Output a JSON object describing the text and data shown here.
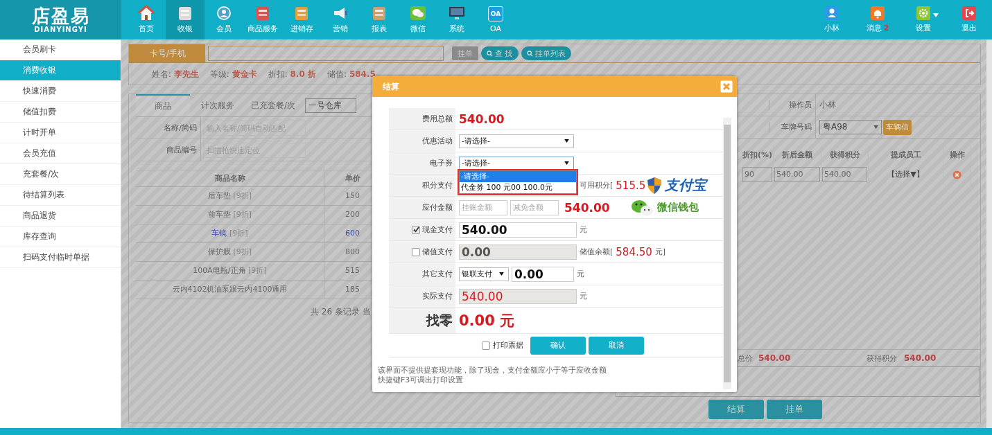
{
  "logo": {
    "name": "店盈易",
    "subtitle": "DIANYINGYI"
  },
  "nav": [
    {
      "label": "首页",
      "selected": false
    },
    {
      "label": "收银",
      "selected": true
    },
    {
      "label": "会员",
      "selected": false
    },
    {
      "label": "商品服务",
      "selected": false
    },
    {
      "label": "进销存",
      "selected": false
    },
    {
      "label": "营销",
      "selected": false
    },
    {
      "label": "报表",
      "selected": false
    },
    {
      "label": "微信",
      "selected": false
    },
    {
      "label": "系统",
      "selected": false
    },
    {
      "label": "OA",
      "selected": false,
      "icon_text": "OA"
    }
  ],
  "user_nav": [
    {
      "label": "小林"
    },
    {
      "label": "消息",
      "badge": "2"
    },
    {
      "label": "设置",
      "has_menu": true
    },
    {
      "label": "退出"
    }
  ],
  "sidebar": {
    "items": [
      {
        "label": "会员刷卡",
        "selected": false
      },
      {
        "label": "消费收银",
        "selected": true
      },
      {
        "label": "快速消费",
        "selected": false
      },
      {
        "label": "储值扣费",
        "selected": false
      },
      {
        "label": "计时开单",
        "selected": false
      },
      {
        "label": "会员充值",
        "selected": false
      },
      {
        "label": "充套餐/次",
        "selected": false
      },
      {
        "label": "待结算列表",
        "selected": false
      },
      {
        "label": "商品退货",
        "selected": false
      },
      {
        "label": "库存查询",
        "selected": false
      },
      {
        "label": "扫码支付临时单据",
        "selected": false
      }
    ]
  },
  "member": {
    "tab": "卡号/手机",
    "buttons": [
      {
        "label": "挂单",
        "disabled": true,
        "search_icon": false
      },
      {
        "label": "查 找",
        "disabled": false,
        "search_icon": true
      },
      {
        "label": "挂单列表",
        "disabled": false,
        "search_icon": true
      }
    ],
    "info": [
      {
        "label": "姓名:",
        "value": "李先生"
      },
      {
        "label": "等级:",
        "value": "黄金卡"
      },
      {
        "label": "折扣:",
        "value": "8.0 折"
      },
      {
        "label": "储值:",
        "value": "584.5"
      }
    ]
  },
  "goods": {
    "tabs": [
      {
        "label": "商品",
        "selected": true
      },
      {
        "label": "计次服务",
        "selected": false
      },
      {
        "label": "已充套餐/次",
        "selected": false
      }
    ],
    "warehouse": "一号仓库",
    "fields": [
      {
        "label": "名称/简码",
        "placeholder": "输入名称/简码自动匹配"
      },
      {
        "label": "商品编号",
        "placeholder": "扫描枪快速定位"
      }
    ],
    "columns": [
      "商品名称",
      "单价"
    ],
    "rows": [
      {
        "name": "后车垫",
        "tag": "[9折]",
        "price": "150",
        "highlighted": false
      },
      {
        "name": "前车垫",
        "tag": "[9折]",
        "price": "200",
        "highlighted": false
      },
      {
        "name": "车镜",
        "tag": "[9折]",
        "price": "600",
        "highlighted": true
      },
      {
        "name": "保护膜",
        "tag": "[9折]",
        "price": "800",
        "highlighted": false
      },
      {
        "name": "100A电瓶/正角",
        "tag": "[9折]",
        "price": "515",
        "highlighted": false
      },
      {
        "name": "云内4102机油泵跟云内4100通用",
        "tag": "",
        "price": "185",
        "highlighted": false
      }
    ],
    "pager": "共 26 条记录 当"
  },
  "order": {
    "operator": {
      "label": "操作员",
      "value": "小林"
    },
    "plate": {
      "label": "车牌号码",
      "value": "粤A98",
      "button": "车辆信"
    },
    "columns": [
      "折扣(%)",
      "折后金额",
      "获得积分",
      "提成员工",
      "操作"
    ],
    "rows": [
      {
        "discount": "90",
        "amount": "540.00",
        "points": "540.00",
        "staff": "【选择▼】"
      }
    ],
    "totals": [
      {
        "label": "总价",
        "value": "540.00"
      },
      {
        "label": "获得积分",
        "value": "540.00"
      }
    ],
    "actions": [
      "结算",
      "挂单"
    ]
  },
  "dialog": {
    "title": "结算",
    "rows": [
      {
        "kind": "amount",
        "label": "费用总额",
        "value": "540.00"
      },
      {
        "kind": "select",
        "label": "优惠活动",
        "value": "-请选择-"
      },
      {
        "kind": "dropdown",
        "label": "电子券",
        "value": "-请选择-",
        "options": [
          {
            "label": "-请选择-",
            "selected": true
          },
          {
            "label": "代金券 100 元00 100.0元",
            "selected": false
          }
        ]
      },
      {
        "kind": "points",
        "label": "积分支付",
        "note": "可用积分[",
        "value": "515.5",
        "logo": "支付宝"
      },
      {
        "kind": "payable",
        "label": "应付金额",
        "placeholders": [
          "挂账金额",
          "减免金额"
        ],
        "value": "540.00",
        "logo": "微信钱包"
      },
      {
        "kind": "pay",
        "label": "现金支付",
        "checked": true,
        "disabled": false,
        "value": "540.00",
        "unit": "元"
      },
      {
        "kind": "pay",
        "label": "储值支付",
        "checked": false,
        "disabled": true,
        "value": "0.00",
        "note": "储值余额[",
        "balance": "584.50",
        "note_end": "元]"
      },
      {
        "kind": "other",
        "label": "其它支付",
        "method": "银联支付",
        "value": "0.00",
        "unit": "元"
      },
      {
        "kind": "actual",
        "label": "实际支付",
        "value": "540.00",
        "unit": "元"
      },
      {
        "kind": "change",
        "label": "找零",
        "value": "0.00 元"
      }
    ],
    "print": {
      "label": "打印票据",
      "checked": false
    },
    "buttons": [
      "确认",
      "取消"
    ],
    "notes": [
      "该界面不提供提套现功能，除了现金，支付金额应小于等于应收金额",
      "快捷键F3可调出打印设置"
    ]
  }
}
